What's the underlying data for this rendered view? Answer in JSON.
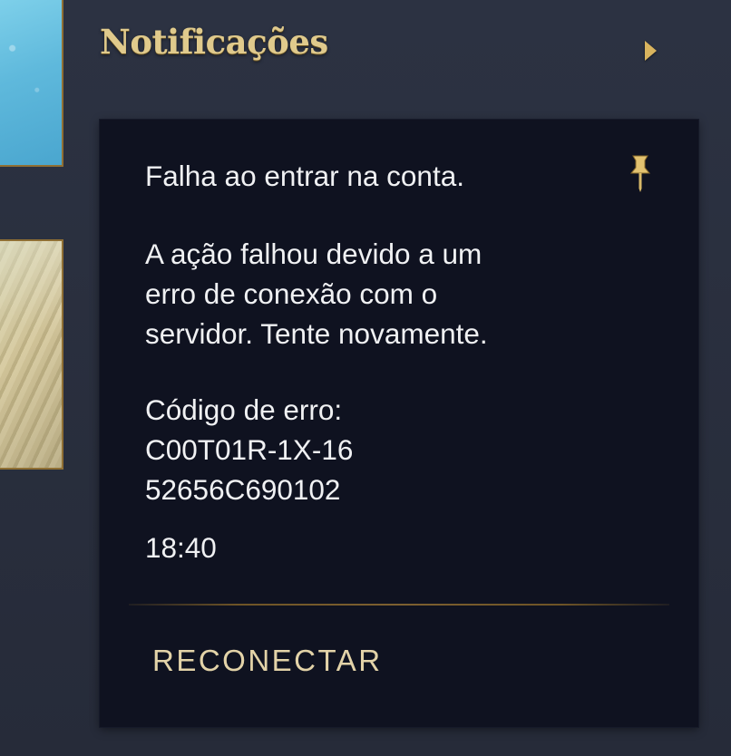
{
  "header": {
    "title": "Notificações",
    "collapse_icon": "chevron-right-icon"
  },
  "notification": {
    "title": "Falha ao entrar na conta.",
    "body": "A ação falhou devido a um\nerro de conexão com o\nservidor. Tente novamente.",
    "error_code": "Código de erro:\nC00T01R-1X-16\n52656C690102",
    "time": "18:40",
    "pin_icon": "pin-icon",
    "action_label": "RECONECTAR"
  },
  "colors": {
    "background": "#2a3040",
    "card": "#0f1220",
    "gold_title": "#e0ca8c",
    "gold_accent": "#d9b45e",
    "text": "#f0f1f3"
  }
}
